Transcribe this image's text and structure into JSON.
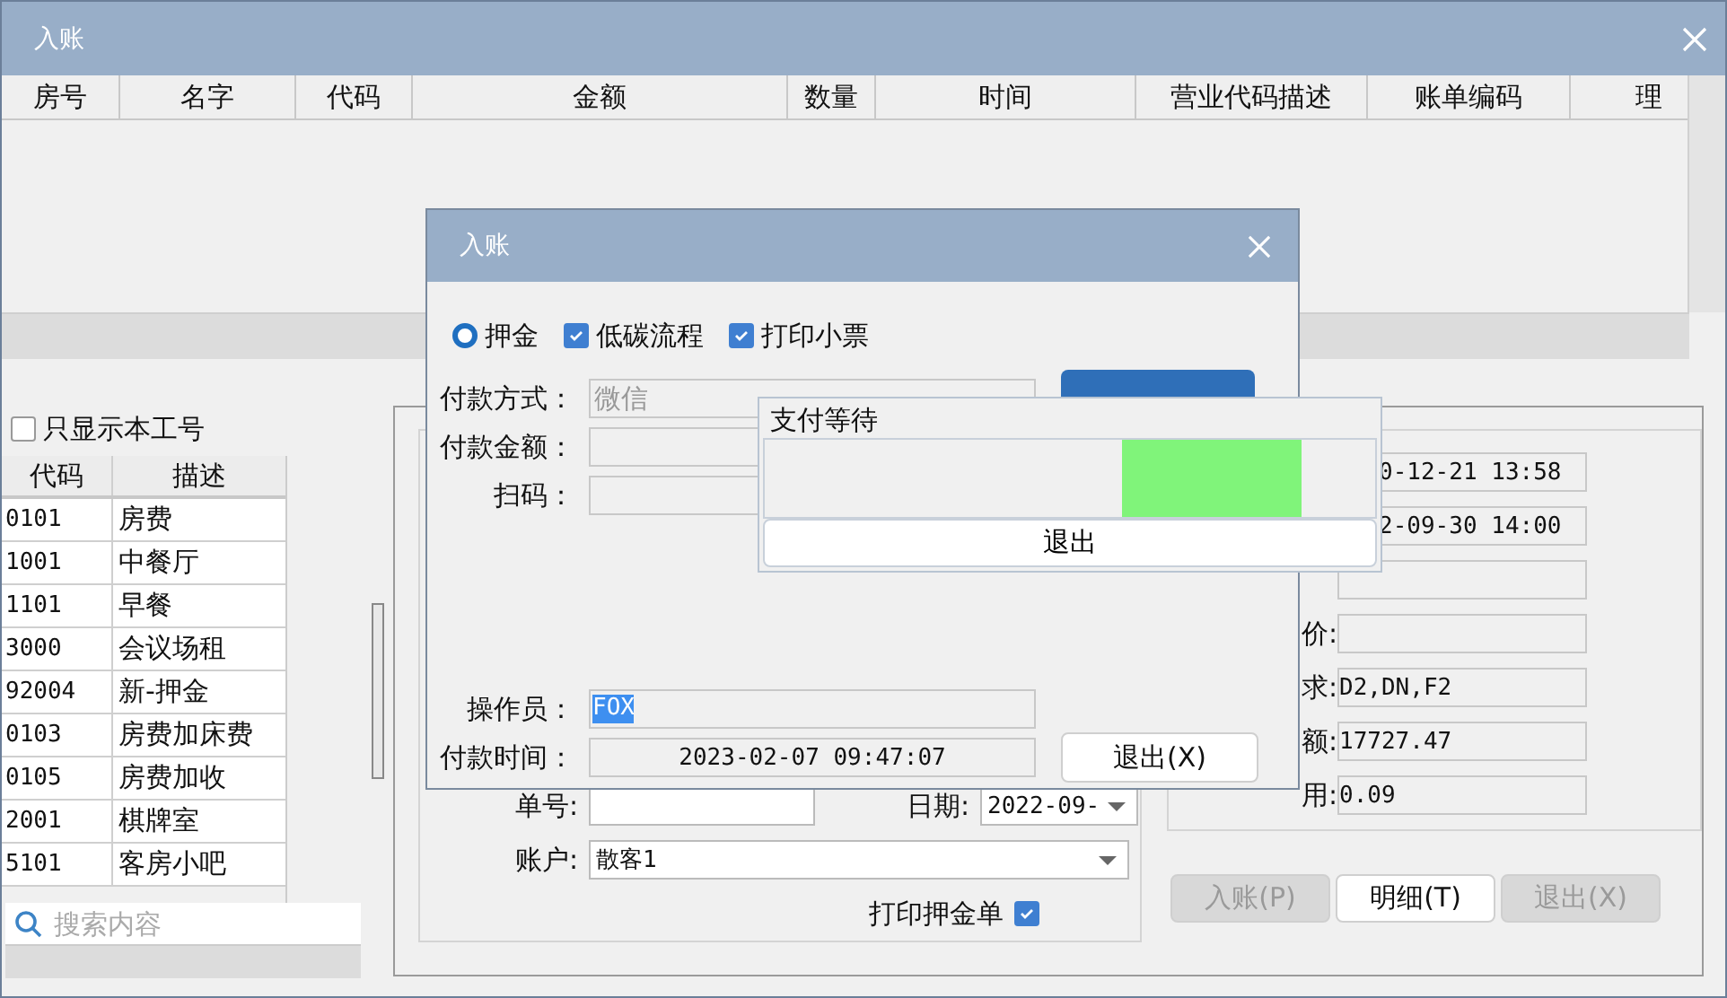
{
  "window": {
    "title": "入账"
  },
  "table": {
    "columns": [
      "房号",
      "名字",
      "代码",
      "金额",
      "数量",
      "时间",
      "营业代码描述",
      "账单编码",
      "理"
    ]
  },
  "filter": {
    "label": "只显示本工号",
    "checked": false
  },
  "codes": {
    "columns": [
      "代码",
      "描述"
    ],
    "rows": [
      {
        "code": "0101",
        "desc": "房费"
      },
      {
        "code": "1001",
        "desc": "中餐厅"
      },
      {
        "code": "1101",
        "desc": "早餐"
      },
      {
        "code": "3000",
        "desc": "会议场租"
      },
      {
        "code": "92004",
        "desc": "新-押金"
      },
      {
        "code": "0103",
        "desc": "房费加床费"
      },
      {
        "code": "0105",
        "desc": "房费加收"
      },
      {
        "code": "2001",
        "desc": "棋牌室"
      },
      {
        "code": "5101",
        "desc": "客房小吧"
      }
    ]
  },
  "search": {
    "placeholder": "搜索内容"
  },
  "form": {
    "order_label": "单号:",
    "date_label": "日期:",
    "date_value": "2022-09-",
    "account_label": "账户:",
    "account_value": "散客1",
    "print_deposit": {
      "label": "打印押金单",
      "checked": true
    }
  },
  "details": [
    {
      "kind": "field",
      "value": "0-12-21 13:58"
    },
    {
      "kind": "field",
      "value": "2-09-30 14:00"
    },
    {
      "kind": "field"
    },
    {
      "kind": "field",
      "label": "价:"
    },
    {
      "kind": "field",
      "label": "求:",
      "value": "D2,DN,F2"
    },
    {
      "kind": "field",
      "label": "额:",
      "value": "17727.47"
    },
    {
      "kind": "field",
      "label": "用:",
      "value": "0.09"
    }
  ],
  "buttons": [
    {
      "label": "入账(P)",
      "disabled": true
    },
    {
      "label": "明细(T)",
      "disabled": false
    },
    {
      "label": "退出(X)",
      "disabled": true
    }
  ],
  "dialog": {
    "title": "入账",
    "options": [
      {
        "kind": "radio",
        "label": "押金",
        "checked": true
      },
      {
        "kind": "checkbox",
        "label": "低碳流程",
        "checked": true
      },
      {
        "kind": "checkbox",
        "label": "打印小票",
        "checked": true
      }
    ],
    "method_label": "付款方式：",
    "method_value": "微信",
    "amount_label": "付款金额：",
    "scan_label": "扫码：",
    "operator_label": "操作员：",
    "operator_value": "FOX",
    "time_label": "付款时间：",
    "time_value": "2023-02-07 09:47:07",
    "exit_button": "退出(X)"
  },
  "popup": {
    "title": "支付等待",
    "button": "退出"
  }
}
